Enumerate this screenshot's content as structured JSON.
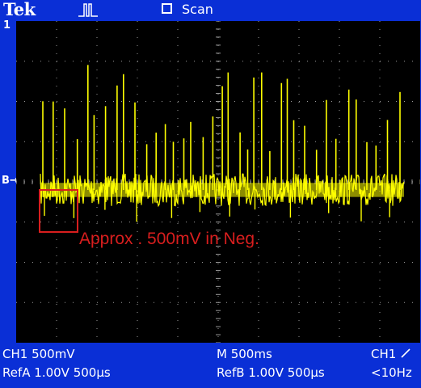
{
  "header": {
    "brand": "Tek",
    "trigger_state_icon": "trigger-pulse-icon",
    "acquisition_mode": "Scan"
  },
  "screen": {
    "channel_marker": "1",
    "ground_marker": "B",
    "annotation": "Approx . 500mV in Neg."
  },
  "status": {
    "ch1_scale": "CH1  500mV",
    "timebase": "M 500ms",
    "trigger_source": "CH1",
    "trigger_slope_icon": "rising-edge-icon",
    "refa": "RefA 1.00V 500µs",
    "refb": "RefB 1.00V 500µs",
    "trigger_frequency": "<10Hz"
  },
  "colors": {
    "background": "#0a2fd6",
    "trace": "#ffff00",
    "annotation": "#d81e1e",
    "grid": "#9a9a9a"
  },
  "trace": {
    "baseline_offset_v": -0.1,
    "noise_band_v": 0.25,
    "negative_peak_v": -0.5,
    "volts_per_div": 0.5
  }
}
